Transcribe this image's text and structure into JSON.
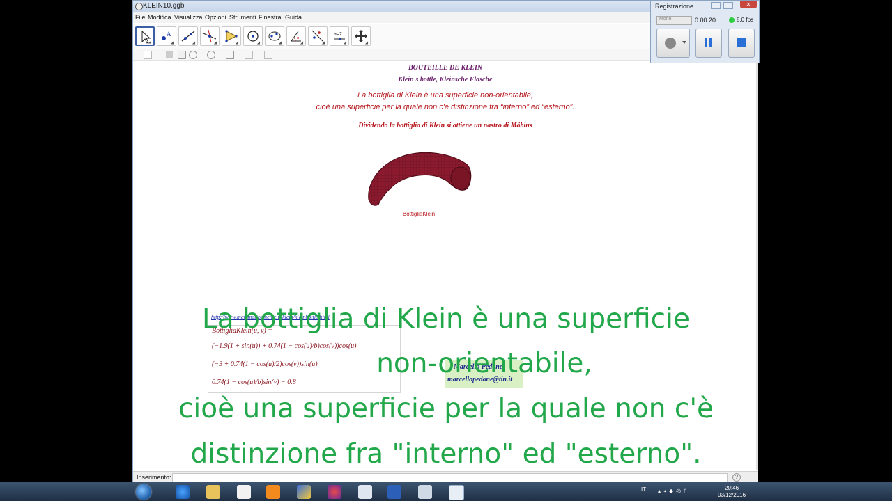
{
  "window": {
    "title": "KLEIN10.ggb"
  },
  "menu": [
    "File",
    "Modifica",
    "Visualizza",
    "Opzioni",
    "Strumenti",
    "Finestra",
    "Guida"
  ],
  "toolbar": {
    "tools": [
      "move-tool",
      "point-tool",
      "line-tool",
      "perpendicular-tool",
      "polygon-tool",
      "circle-tool",
      "conic-tool",
      "angle-tool",
      "reflect-tool",
      "slider-tool",
      "move-view-tool"
    ],
    "slider_label": "a=2"
  },
  "canvas": {
    "title1": "BOUTEILLE DE KLEIN",
    "title2": "Klein's bottle, Kleinsche Flasche",
    "desc1": "La bottiglia di Klein  è una superficie non-orientabile,",
    "desc2": "cioè una superficie per la quale non c'è distinzione fra “interno” ed “esterno”.",
    "desc3": "Dividendo la bottiglia di Klein si ottiene un nastro di Möbius",
    "object_label": "BottigliaKlein",
    "link": "http://www.matematicamente.it/klein/kleinbottle.html",
    "formula": {
      "line0": "BottigliaKlein(u, v) =",
      "line1": "(−1.9(1 + sin(u)) + 0.74(1 − cos(u)/b)cos(v))cos(u)",
      "line2": "(−3 + 0.74(1 − cos(u)/2)cos(v))sin(u)",
      "line3": "0.74(1 − cos(u)/b)sin(v) − 0.8"
    },
    "author_name": "Marcello Pedone",
    "author_email": "marcellopedone@tin.it"
  },
  "input_bar": {
    "label": "Inserimento:",
    "value": ""
  },
  "subtitle": {
    "line1": "La bottiglia di Klein  è una superficie",
    "line2": "non-orientabile,",
    "line3": "cioè una superficie per la quale non c'è",
    "line4": "distinzione fra \"interno\" ed \"esterno\"."
  },
  "recorder": {
    "title": "Registrazione ...",
    "mode": "Mono",
    "elapsed": "0:00:20",
    "fps": "8.0 fps",
    "status_color": "#2ecc40"
  },
  "taskbar": {
    "language": "IT",
    "time": "20:46",
    "date": "03/12/2016"
  },
  "colors": {
    "subtitle": "#22a84a",
    "title": "#6a1f6a",
    "text_red": "#b5151b",
    "surface": "#8b1a2e"
  }
}
